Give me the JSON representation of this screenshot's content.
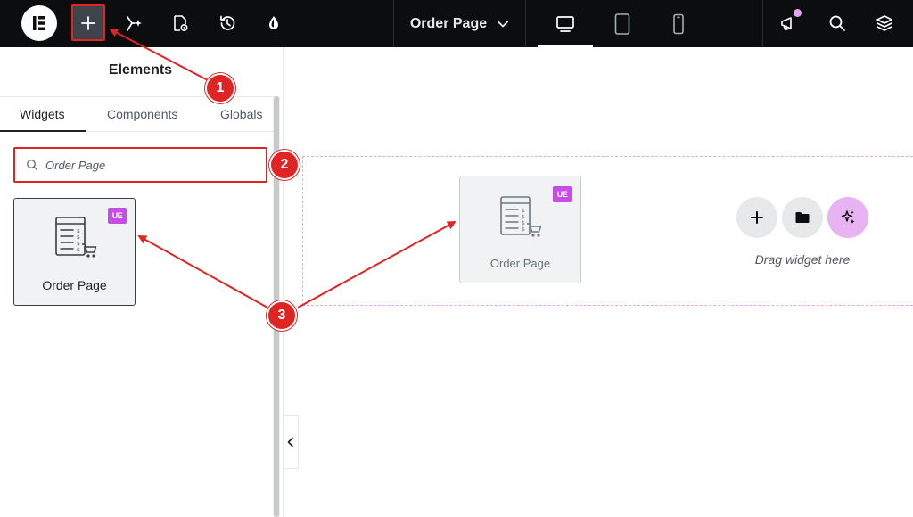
{
  "topbar": {
    "page_title": "Order Page"
  },
  "panel": {
    "title": "Elements",
    "tabs": [
      {
        "label": "Widgets",
        "active": true
      },
      {
        "label": "Components",
        "active": false
      },
      {
        "label": "Globals",
        "active": false
      }
    ],
    "search": {
      "value": "Order Page"
    },
    "widget": {
      "label": "Order Page",
      "badge": "UE"
    }
  },
  "canvas": {
    "widget": {
      "label": "Order Page",
      "badge": "UE"
    },
    "drag_hint": "Drag widget here"
  },
  "annotations": {
    "steps": [
      "1",
      "2",
      "3"
    ]
  },
  "colors": {
    "topbar": "#0c0d0e",
    "accent_pink": "#c74ce5",
    "annotation_red": "#e02424"
  }
}
